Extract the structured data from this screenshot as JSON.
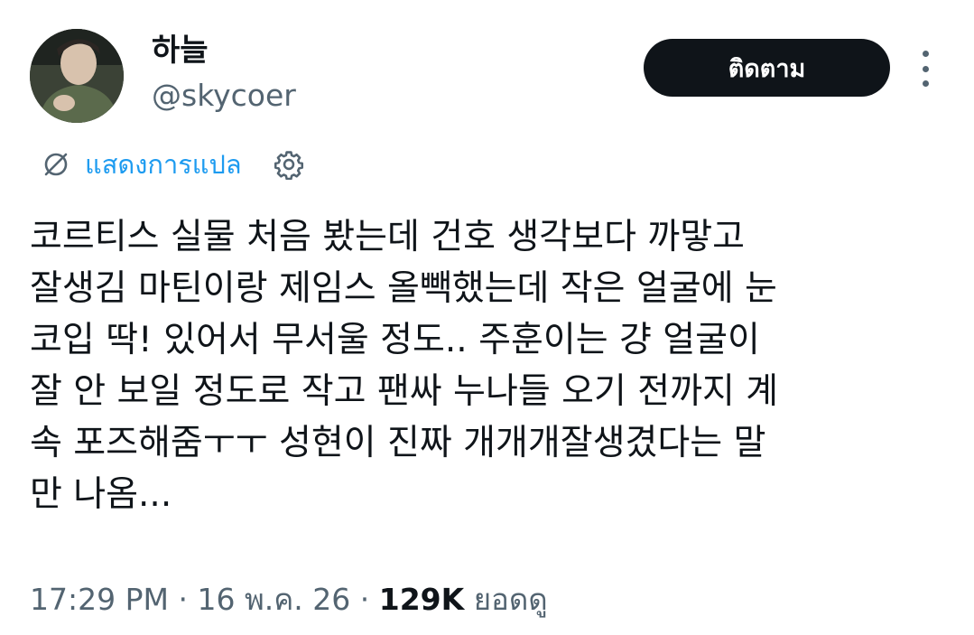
{
  "user": {
    "display_name": "하늘",
    "handle": "@skycoer"
  },
  "actions": {
    "follow_label": "ติดตาม",
    "more_icon": "more-vertical-icon"
  },
  "translate": {
    "label": "แสดงการแปล",
    "icon": "translate-icon",
    "settings_icon": "gear-icon"
  },
  "tweet": {
    "text": "코르티스 실물 처음 봤는데 건호 생각보다 까맣고\n잘생김 마틴이랑 제임스 올빽했는데 작은 얼굴에 눈\n코입 딱! 있어서 무서울 정도.. 주훈이는 걍 얼굴이\n잘 안 보일 정도로 작고 팬싸 누나들 오기 전까지 계\n속 포즈해줌ㅜㅜ 성현이 진짜 개개개잘생겼다는 말\n만 나옴..."
  },
  "meta": {
    "time": "17:29 PM",
    "separator": "·",
    "date": "16 พ.ค. 26",
    "views_count": "129K",
    "views_label": "ยอดดู"
  },
  "colors": {
    "accent": "#1d9bf0",
    "text": "#0f1419",
    "secondary": "#536471",
    "button": "#0f1419"
  }
}
